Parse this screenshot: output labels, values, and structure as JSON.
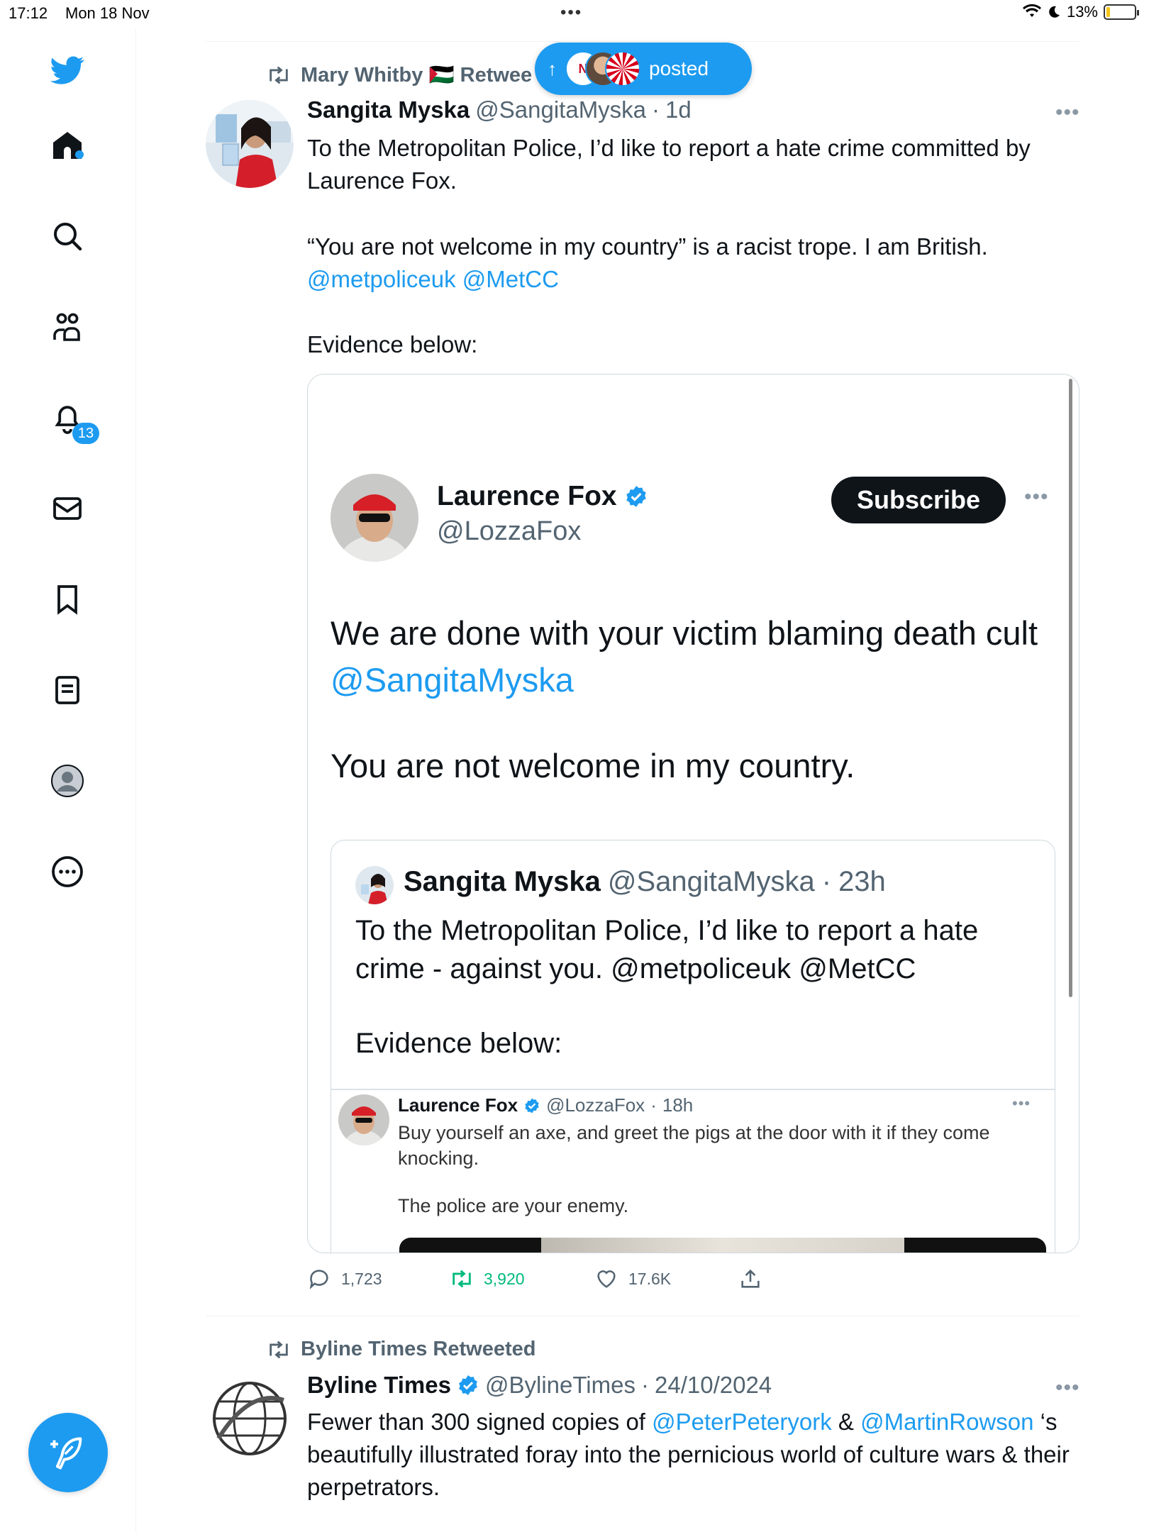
{
  "status_bar": {
    "time": "17:12",
    "date": "Mon 18 Nov",
    "battery": "13%",
    "battery_level": 0.13
  },
  "sidebar": {
    "notifications_badge": "13",
    "items": [
      "twitter-logo",
      "home",
      "search",
      "communities",
      "notifications",
      "messages",
      "bookmarks",
      "lists",
      "profile",
      "more"
    ]
  },
  "new_posts_pill": {
    "label": "posted"
  },
  "tweet1": {
    "retweeted_by": "Mary Whitby 🇵🇸 Retweeted",
    "author_name": "Sangita Myska",
    "handle": "@SangitaMyska",
    "time": "1d",
    "text_line1": "To the Metropolitan Police, I’d like to report a hate crime committed by Laurence Fox.",
    "text_line2": "“You are not welcome in my country” is a racist trope. I am British.",
    "mention1": "@metpoliceuk",
    "mention2": "@MetCC",
    "text_line3": "Evidence below:",
    "embed": {
      "name": "Laurence Fox",
      "handle": "@LozzaFox",
      "subscribe": "Subscribe",
      "text1": "We are done with your victim blaming death cult",
      "mention": "@SangitaMyska",
      "text2": "You are not welcome in my country.",
      "quote": {
        "name": "Sangita Myska",
        "handle": "@SangitaMyska",
        "time": "23h",
        "text": "To the Metropolitan Police, I’d like to report a hate crime - against you.  @metpoliceuk @MetCC",
        "text_evidence": "Evidence below:",
        "inner": {
          "name": "Laurence Fox",
          "handle": "@LozzaFox",
          "time": "18h",
          "text1": "Buy yourself an axe, and greet the pigs at the door with it if they come knocking.",
          "text2": "The police are your enemy."
        }
      }
    },
    "actions": {
      "replies": "1,723",
      "retweets": "3,920",
      "likes": "17.6K"
    }
  },
  "tweet2": {
    "retweeted_by": "Byline Times Retweeted",
    "author_name": "Byline Times",
    "handle": "@BylineTimes",
    "time": "24/10/2024",
    "text_a": "Fewer than 300 signed copies of ",
    "mention1": "@PeterPeteryork",
    "text_b": " & ",
    "mention2": "@MartinRowson",
    "text_c": " ‘s beautifully illustrated foray into the pernicious world of culture wars & their perpetrators."
  },
  "colors": {
    "accent": "#1d9bf0",
    "retweet_green": "#00ba7c",
    "text": "#0f1419",
    "secondary": "#536471"
  }
}
